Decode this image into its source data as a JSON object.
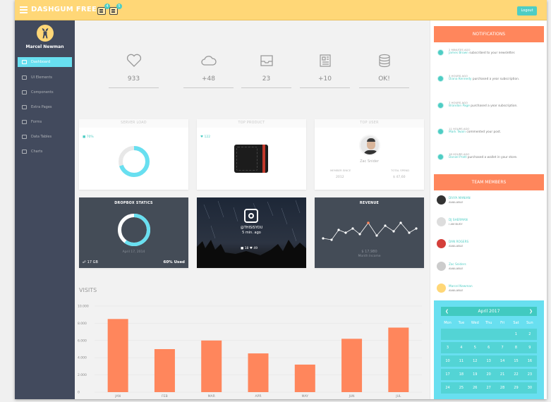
{
  "header": {
    "logo": "DASHGUM FREE",
    "badges": [
      "4",
      "5"
    ],
    "logout_label": "Logout"
  },
  "sidebar": {
    "user_name": "Marcel Newman",
    "items": [
      {
        "label": "Dashboard",
        "active": true
      },
      {
        "label": "UI Elements"
      },
      {
        "label": "Components"
      },
      {
        "label": "Extra Pages"
      },
      {
        "label": "Forms"
      },
      {
        "label": "Data Tables"
      },
      {
        "label": "Charts"
      }
    ]
  },
  "stats": [
    {
      "icon": "heart-icon",
      "value": "933"
    },
    {
      "icon": "cloud-icon",
      "value": "+48"
    },
    {
      "icon": "inbox-icon",
      "value": "23"
    },
    {
      "icon": "newspaper-icon",
      "value": "+10"
    },
    {
      "icon": "database-icon",
      "value": "OK!"
    }
  ],
  "server_load": {
    "title": "SERVER LOAD",
    "value_label": "70%",
    "fraction": 0.7
  },
  "top_product": {
    "title": "TOP PRODUCT",
    "likes": "122"
  },
  "top_user": {
    "title": "TOP USER",
    "name": "Zac Snider",
    "member_since_label": "MEMBER SINCE",
    "member_since": "2012",
    "total_spend_label": "TOTAL SPEND",
    "total_spend": "$ 47,60"
  },
  "dropbox": {
    "title": "DROPBOX STATICS",
    "date": "April 17, 2014",
    "size": "17 GB",
    "used": "60% Used",
    "fraction": 0.6
  },
  "instagram": {
    "handle": "@THISISYOU",
    "time": "5 min. ago",
    "comments": "18",
    "likes": "49"
  },
  "revenue": {
    "title": "REVENUE",
    "amount": "$ 17,980",
    "caption": "Month Income"
  },
  "visits": {
    "title": "VISITS",
    "chart_data": {
      "type": "bar",
      "categories": [
        "JAN",
        "FEB",
        "MAR",
        "APR",
        "MAY",
        "JUN",
        "JUL"
      ],
      "values": [
        8500,
        5000,
        6000,
        4500,
        3200,
        6200,
        7500
      ],
      "ylim": [
        0,
        10000
      ],
      "yticks": [
        "0",
        "2.000",
        "4.000",
        "6.000",
        "8.000",
        "10.000"
      ],
      "color": "#ff865c"
    }
  },
  "notifications": {
    "title": "NOTIFICATIONS",
    "items": [
      {
        "time": "2 MINUTES AGO",
        "who": "James Brown",
        "text": "subscribed to your newsletter."
      },
      {
        "time": "3 HOURS AGO",
        "who": "Diana Kennedy",
        "text": "purchased a year subscription."
      },
      {
        "time": "7 HOURS AGO",
        "who": "Brandon Page",
        "text": "purchased a year subscription."
      },
      {
        "time": "11 HOURS AGO",
        "who": "Mark Twain",
        "text": "commented your post."
      },
      {
        "time": "18 HOURS AGO",
        "who": "Daniel Pratt",
        "text": "purchased a wallet in your store."
      }
    ]
  },
  "team": {
    "title": "TEAM MEMBERS",
    "members": [
      {
        "name": "DIVYA MANIAN",
        "status": "AVAILABLE",
        "color": "#333333"
      },
      {
        "name": "DJ SHERMAN",
        "status": "I AM BUSY",
        "color": "#dddddd"
      },
      {
        "name": "DAN ROGERS",
        "status": "AVAILABLE",
        "color": "#d43f3a"
      },
      {
        "name": "Zac Sniders",
        "status": "AVAILABLE",
        "color": "#cccccc"
      },
      {
        "name": "Marcel Newman",
        "status": "AVAILABLE",
        "color": "#ffd777"
      }
    ]
  },
  "calendar": {
    "month": "April 2017",
    "days": [
      "Mon",
      "Tue",
      "Wed",
      "Thu",
      "Fri",
      "Sat",
      "Sun"
    ],
    "weeks": [
      [
        "",
        "",
        "",
        "",
        "",
        "1",
        "2"
      ],
      [
        "3",
        "4",
        "5",
        "6",
        "7",
        "8",
        "9"
      ],
      [
        "10",
        "11",
        "12",
        "13",
        "14",
        "15",
        "16"
      ],
      [
        "17",
        "18",
        "19",
        "20",
        "21",
        "22",
        "23"
      ],
      [
        "24",
        "25",
        "26",
        "27",
        "28",
        "29",
        "30"
      ]
    ]
  }
}
